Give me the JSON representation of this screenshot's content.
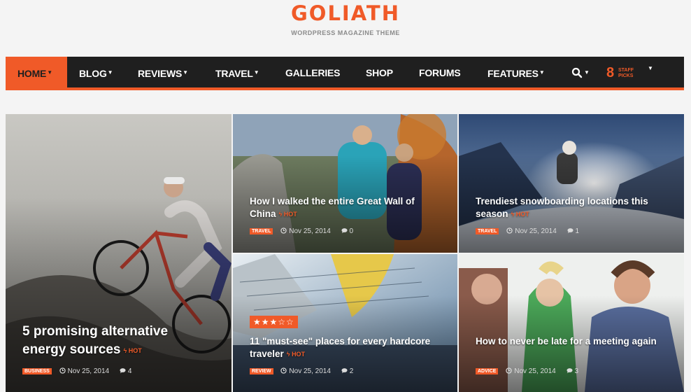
{
  "site": {
    "logo": "GOLIATH",
    "tagline": "WORDPRESS MAGAZINE THEME"
  },
  "nav": {
    "items": [
      {
        "label": "HOME",
        "caret": true,
        "active": true
      },
      {
        "label": "BLOG",
        "caret": true
      },
      {
        "label": "REVIEWS",
        "caret": true
      },
      {
        "label": "TRAVEL",
        "caret": true
      },
      {
        "label": "GALLERIES",
        "caret": false
      },
      {
        "label": "SHOP",
        "caret": false
      },
      {
        "label": "FORUMS",
        "caret": false
      },
      {
        "label": "FEATURES",
        "caret": true
      }
    ],
    "caret_glyph": "▼",
    "search_icon": "search-icon",
    "staff_picks": {
      "number": "8",
      "label": "STAFF PICKS"
    }
  },
  "hot_label": "HOT",
  "articles": [
    {
      "title": "5 promising alternative energy sources",
      "hot": true,
      "category": "BUSINESS",
      "date": "Nov 25, 2014",
      "comments": "4"
    },
    {
      "title": "How I walked the entire Great Wall of China",
      "hot": true,
      "category": "TRAVEL",
      "date": "Nov 25, 2014",
      "comments": "0"
    },
    {
      "title": "Trendiest snowboarding locations this season",
      "hot": true,
      "category": "TRAVEL",
      "date": "Nov 25, 2014",
      "comments": "1"
    },
    {
      "title": "11 \"must-see\" places for every hardcore traveler",
      "hot": true,
      "category": "REVIEW",
      "date": "Nov 25, 2014",
      "comments": "2",
      "rating_stars": "★★★☆☆",
      "rating": 3
    },
    {
      "title": "How to never be late for a meeting again",
      "hot": false,
      "category": "ADVICE",
      "date": "Nov 25, 2014",
      "comments": "3"
    }
  ],
  "colors": {
    "accent": "#f05a28",
    "nav_bg": "#1f1f1f",
    "page_bg": "#f4f4f4"
  }
}
